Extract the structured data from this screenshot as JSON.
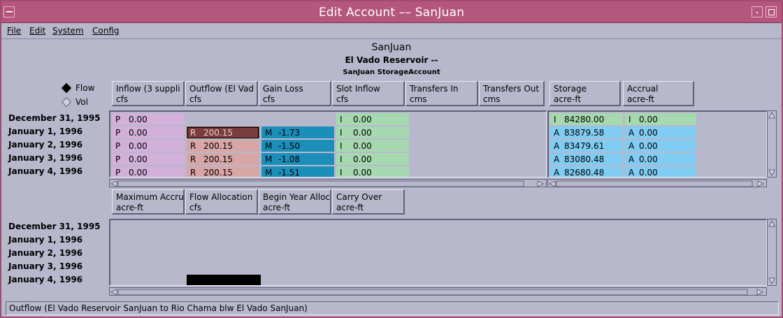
{
  "window": {
    "title": "Edit Account –– SanJuan"
  },
  "menu": [
    {
      "label": "File"
    },
    {
      "label": "Edit"
    },
    {
      "label": "System"
    },
    {
      "label": "Config"
    }
  ],
  "header": {
    "object": "SanJuan",
    "reservoir": "El Vado Reservoir --",
    "account": "SanJuan StorageAccount"
  },
  "mode": {
    "flow_label": "Flow",
    "vol_label": "Vol",
    "selected": "Flow"
  },
  "top_columns": [
    {
      "name": "Inflow (3 suppli",
      "unit": "cfs"
    },
    {
      "name": "Outflow (El Vad",
      "unit": "cfs"
    },
    {
      "name": "Gain Loss",
      "unit": "cfs"
    },
    {
      "name": "Slot Inflow",
      "unit": "cfs"
    },
    {
      "name": "Transfers In",
      "unit": "cms"
    },
    {
      "name": "Transfers Out",
      "unit": "cms"
    }
  ],
  "right_columns": [
    {
      "name": "Storage",
      "unit": "acre-ft"
    },
    {
      "name": "Accrual",
      "unit": "acre-ft"
    }
  ],
  "dates": [
    "December 31, 1995",
    "January 1, 1996",
    "January 2, 1996",
    "January 3, 1996",
    "January 4, 1996"
  ],
  "top_rows": [
    {
      "inflow": [
        "P",
        "0.00"
      ],
      "outflow": [
        "",
        ""
      ],
      "gain": [
        "",
        ""
      ],
      "slot": [
        "I",
        "0.00"
      ],
      "storage": [
        "I",
        "84280.00"
      ],
      "accrual": [
        "I",
        "0.00"
      ]
    },
    {
      "inflow": [
        "P",
        "0.00"
      ],
      "outflow": [
        "R",
        "200.15"
      ],
      "gain": [
        "M",
        "-1.73"
      ],
      "slot": [
        "I",
        "0.00"
      ],
      "storage": [
        "A",
        "83879.58"
      ],
      "accrual": [
        "A",
        "0.00"
      ]
    },
    {
      "inflow": [
        "P",
        "0.00"
      ],
      "outflow": [
        "R",
        "200.15"
      ],
      "gain": [
        "M",
        "-1.50"
      ],
      "slot": [
        "I",
        "0.00"
      ],
      "storage": [
        "A",
        "83479.61"
      ],
      "accrual": [
        "A",
        "0.00"
      ]
    },
    {
      "inflow": [
        "P",
        "0.00"
      ],
      "outflow": [
        "R",
        "200.15"
      ],
      "gain": [
        "M",
        "-1.08"
      ],
      "slot": [
        "I",
        "0.00"
      ],
      "storage": [
        "A",
        "83080.48"
      ],
      "accrual": [
        "A",
        "0.00"
      ]
    },
    {
      "inflow": [
        "P",
        "0.00"
      ],
      "outflow": [
        "R",
        "200.15"
      ],
      "gain": [
        "M",
        "-1.51"
      ],
      "slot": [
        "I",
        "0.00"
      ],
      "storage": [
        "A",
        "82680.48"
      ],
      "accrual": [
        "A",
        "0.00"
      ]
    }
  ],
  "bottom_columns": [
    {
      "name": "Maximum Accru",
      "unit": "acre-ft"
    },
    {
      "name": "Flow Allocation",
      "unit": "cfs"
    },
    {
      "name": "Begin Year Alloc",
      "unit": "acre-ft"
    },
    {
      "name": "Carry Over",
      "unit": "acre-ft"
    }
  ],
  "status": {
    "text": "Outflow (El Vado Reservoir SanJuan to Rio Chama blw El Vado SanJuan)"
  },
  "colors": {
    "title_bar": "#b5577d",
    "inflow": "#d2b0da",
    "outflow": "#d9a6a6",
    "gain": "#1b8fba",
    "slot": "#a6d9b0",
    "storage": "#80ccf2",
    "selected": "#7a3c3c"
  }
}
